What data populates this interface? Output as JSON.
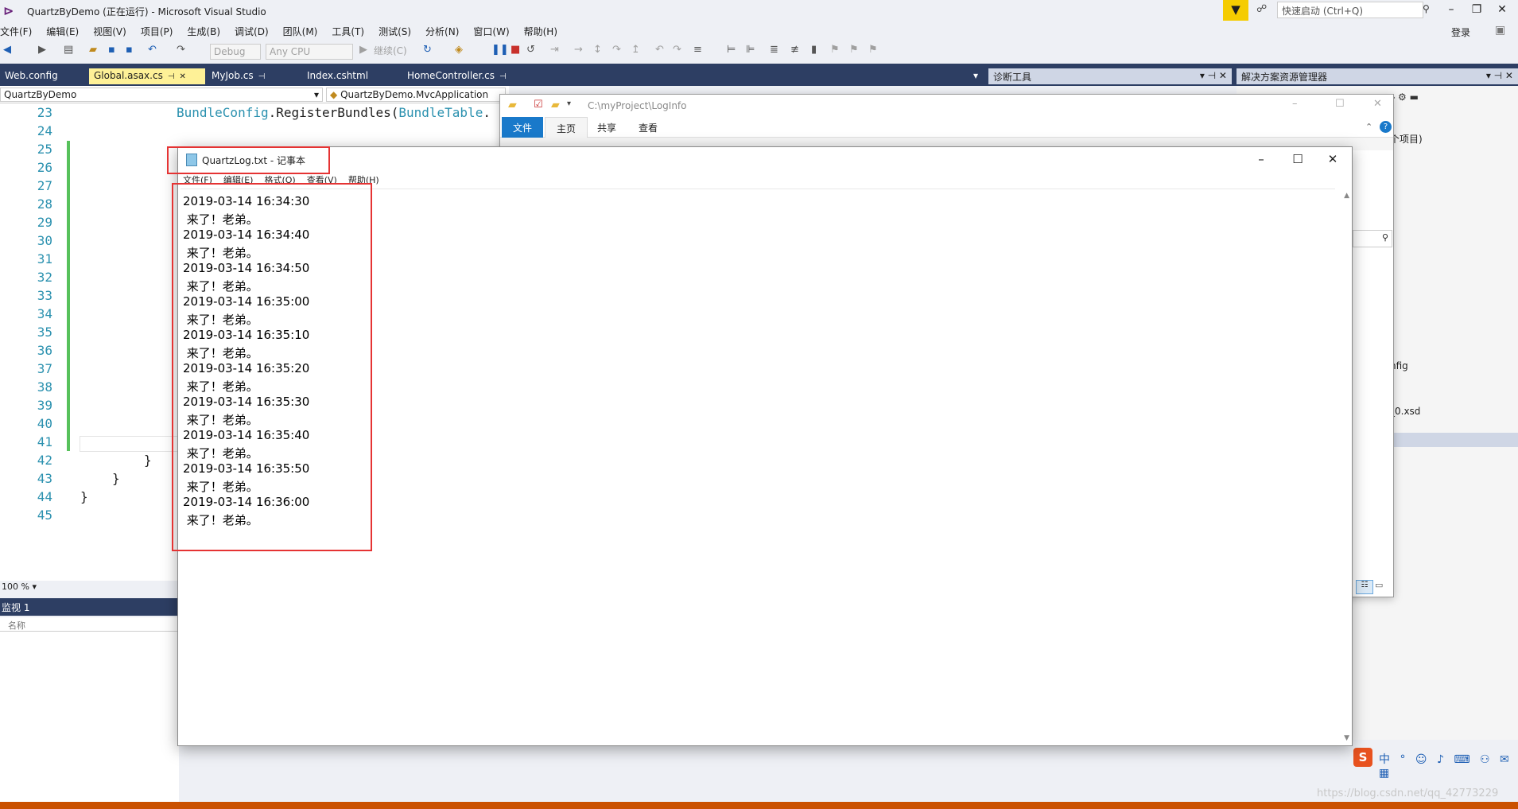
{
  "vs": {
    "title": "QuartzByDemo (正在运行) - Microsoft Visual Studio",
    "quick_launch_placeholder": "快速启动 (Ctrl+Q)",
    "login": "登录",
    "menu": [
      "文件(F)",
      "编辑(E)",
      "视图(V)",
      "项目(P)",
      "生成(B)",
      "调试(D)",
      "团队(M)",
      "工具(T)",
      "测试(S)",
      "分析(N)",
      "窗口(W)",
      "帮助(H)"
    ],
    "toolbar": {
      "config": "Debug",
      "platform": "Any CPU",
      "continue": "继续(C)"
    },
    "tabs": [
      "Web.config",
      "Global.asax.cs",
      "MyJob.cs",
      "Index.cshtml",
      "HomeController.cs"
    ],
    "active_tab": "Global.asax.cs",
    "nav": {
      "project": "QuartzByDemo",
      "class": "QuartzByDemo.MvcApplication"
    },
    "line_numbers": [
      "23",
      "24",
      "25",
      "26",
      "27",
      "28",
      "29",
      "30",
      "31",
      "32",
      "33",
      "34",
      "35",
      "36",
      "37",
      "38",
      "39",
      "40",
      "41",
      "42",
      "43",
      "44",
      "45"
    ],
    "code": {
      "line23_a": "BundleConfig",
      "line23_b": ".RegisterBundles(",
      "line23_c": "BundleTable",
      "line23_d": ".",
      "line42": "}",
      "line43": "}",
      "line44": "}"
    },
    "zoom": "100 %",
    "diagnostics_title": "诊断工具",
    "solution_explorer_title": "解决方案资源管理器",
    "solution_fragments": [
      "个项目)",
      "nfig",
      "_0.xsd"
    ],
    "watch_title": "监视 1",
    "watch_column": "名称",
    "watermark": "https://blog.csdn.net/qq_42773229"
  },
  "explorer": {
    "path": "C:\\myProject\\LogInfo",
    "ribbon_tabs": [
      "文件",
      "主页",
      "共享",
      "查看"
    ]
  },
  "notepad": {
    "title": "QuartzLog.txt - 记事本",
    "menu": [
      "文件(F)",
      "编辑(E)",
      "格式(O)",
      "查看(V)",
      "帮助(H)"
    ],
    "lines": [
      "2019-03-14 16:34:30",
      " 来了！老弟。",
      "2019-03-14 16:34:40",
      " 来了！老弟。",
      "2019-03-14 16:34:50",
      " 来了！老弟。",
      "2019-03-14 16:35:00",
      " 来了！老弟。",
      "2019-03-14 16:35:10",
      " 来了！老弟。",
      "2019-03-14 16:35:20",
      " 来了！老弟。",
      "2019-03-14 16:35:30",
      " 来了！老弟。",
      "2019-03-14 16:35:40",
      " 来了！老弟。",
      "2019-03-14 16:35:50",
      " 来了！老弟。",
      "2019-03-14 16:36:00",
      " 来了！老弟。"
    ]
  },
  "colors": {
    "vs_dark": "#2d3e63",
    "active_tab": "#fef197",
    "annotation_red": "#e53333",
    "line_number": "#2b91af",
    "status_bar": "#ca5100"
  }
}
